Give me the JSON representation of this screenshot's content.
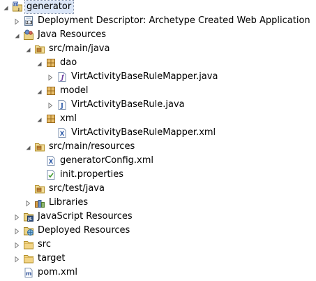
{
  "tree": [
    {
      "label": "generator",
      "icon": "maven-project-icon",
      "arrow": "expanded",
      "level": 0,
      "selected": true
    },
    {
      "label": "Deployment Descriptor: Archetype Created Web Application",
      "icon": "deployment-descriptor-icon",
      "arrow": "collapsed",
      "level": 1
    },
    {
      "label": "Java Resources",
      "icon": "java-resources-icon",
      "arrow": "expanded",
      "level": 1
    },
    {
      "label": "src/main/java",
      "icon": "source-folder-icon",
      "arrow": "expanded",
      "level": 2
    },
    {
      "label": "dao",
      "icon": "package-icon",
      "arrow": "expanded",
      "level": 3
    },
    {
      "label": "VirtActivityBaseRuleMapper.java",
      "icon": "java-interface-file-icon",
      "arrow": "collapsed",
      "level": 4
    },
    {
      "label": "model",
      "icon": "package-icon",
      "arrow": "expanded",
      "level": 3
    },
    {
      "label": "VirtActivityBaseRule.java",
      "icon": "java-file-icon",
      "arrow": "collapsed",
      "level": 4
    },
    {
      "label": "xml",
      "icon": "package-icon",
      "arrow": "expanded",
      "level": 3
    },
    {
      "label": "VirtActivityBaseRuleMapper.xml",
      "icon": "xml-file-icon",
      "arrow": "none",
      "level": 4
    },
    {
      "label": "src/main/resources",
      "icon": "source-folder-icon",
      "arrow": "expanded",
      "level": 2
    },
    {
      "label": "generatorConfig.xml",
      "icon": "xml-file-icon",
      "arrow": "none",
      "level": 3
    },
    {
      "label": "init.properties",
      "icon": "properties-file-icon",
      "arrow": "none",
      "level": 3
    },
    {
      "label": "src/test/java",
      "icon": "source-folder-icon",
      "arrow": "none",
      "level": 2
    },
    {
      "label": "Libraries",
      "icon": "libraries-icon",
      "arrow": "collapsed",
      "level": 2
    },
    {
      "label": "JavaScript Resources",
      "icon": "javascript-resources-icon",
      "arrow": "collapsed",
      "level": 1
    },
    {
      "label": "Deployed Resources",
      "icon": "deployed-resources-icon",
      "arrow": "collapsed",
      "level": 1
    },
    {
      "label": "src",
      "icon": "folder-icon",
      "arrow": "collapsed",
      "level": 1
    },
    {
      "label": "target",
      "icon": "folder-icon",
      "arrow": "collapsed",
      "level": 1
    },
    {
      "label": "pom.xml",
      "icon": "maven-pom-file-icon",
      "arrow": "none",
      "level": 1
    }
  ]
}
